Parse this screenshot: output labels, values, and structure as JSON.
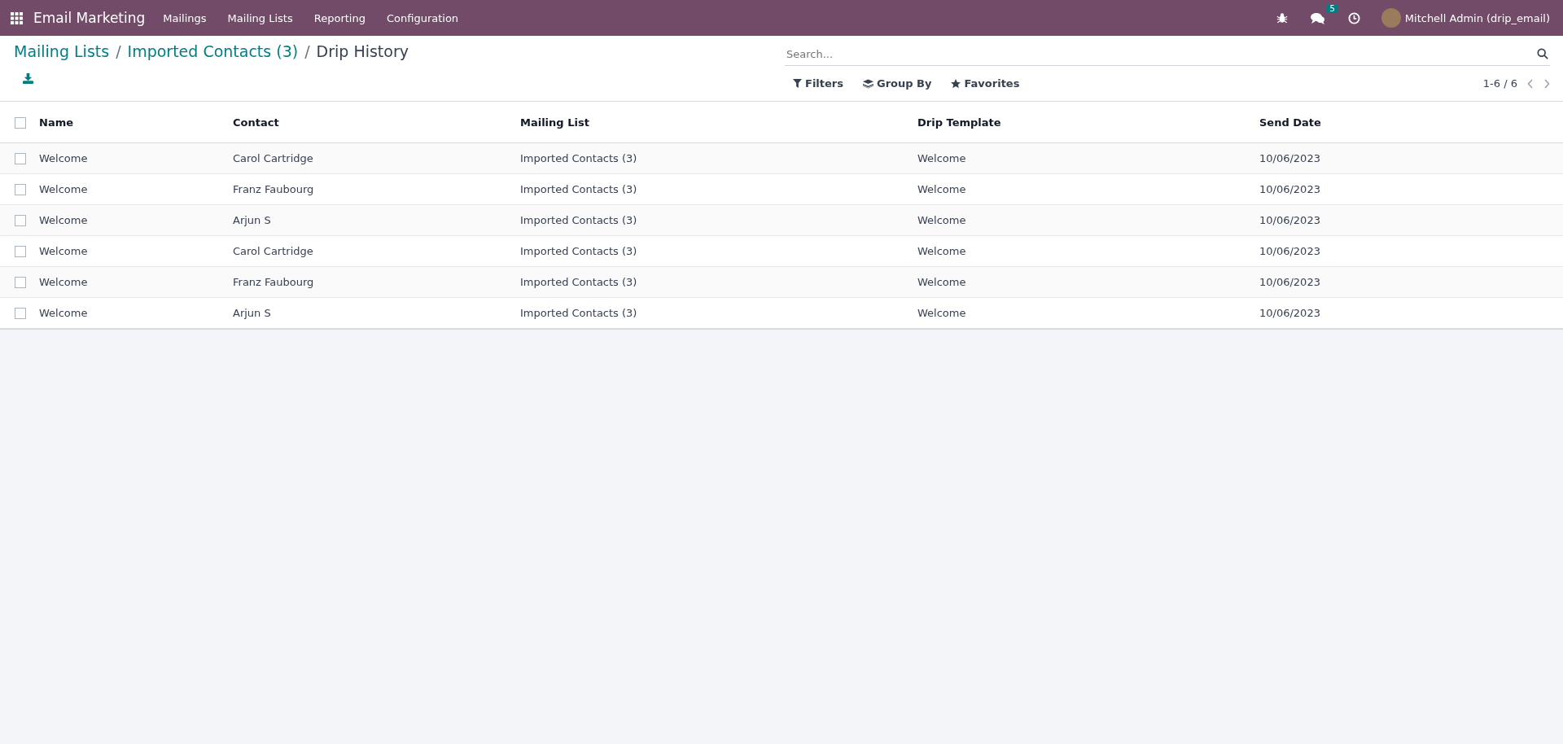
{
  "navbar": {
    "app_name": "Email Marketing",
    "menu": [
      "Mailings",
      "Mailing Lists",
      "Reporting",
      "Configuration"
    ],
    "message_count": "5",
    "user": "Mitchell Admin (drip_email)"
  },
  "breadcrumb_separator": "/",
  "breadcrumbs": [
    {
      "label": "Mailing Lists",
      "link": true
    },
    {
      "label": "Imported Contacts (3)",
      "link": true
    },
    {
      "label": "Drip History",
      "link": false
    }
  ],
  "search": {
    "placeholder": "Search..."
  },
  "search_options": [
    "Filters",
    "Group By",
    "Favorites"
  ],
  "pager": "1-6 / 6",
  "table": {
    "columns": [
      "Name",
      "Contact",
      "Mailing List",
      "Drip Template",
      "Send Date"
    ],
    "all_checked": false,
    "rows": [
      {
        "checked": false,
        "cells": [
          "Welcome",
          "Carol Cartridge",
          "Imported Contacts (3)",
          "Welcome",
          "10/06/2023"
        ]
      },
      {
        "checked": false,
        "cells": [
          "Welcome",
          "Franz Faubourg",
          "Imported Contacts (3)",
          "Welcome",
          "10/06/2023"
        ]
      },
      {
        "checked": false,
        "cells": [
          "Welcome",
          "Arjun S",
          "Imported Contacts (3)",
          "Welcome",
          "10/06/2023"
        ]
      },
      {
        "checked": false,
        "cells": [
          "Welcome",
          "Carol Cartridge",
          "Imported Contacts (3)",
          "Welcome",
          "10/06/2023"
        ]
      },
      {
        "checked": false,
        "cells": [
          "Welcome",
          "Franz Faubourg",
          "Imported Contacts (3)",
          "Welcome",
          "10/06/2023"
        ]
      },
      {
        "checked": false,
        "cells": [
          "Welcome",
          "Arjun S",
          "Imported Contacts (3)",
          "Welcome",
          "10/06/2023"
        ]
      }
    ]
  }
}
